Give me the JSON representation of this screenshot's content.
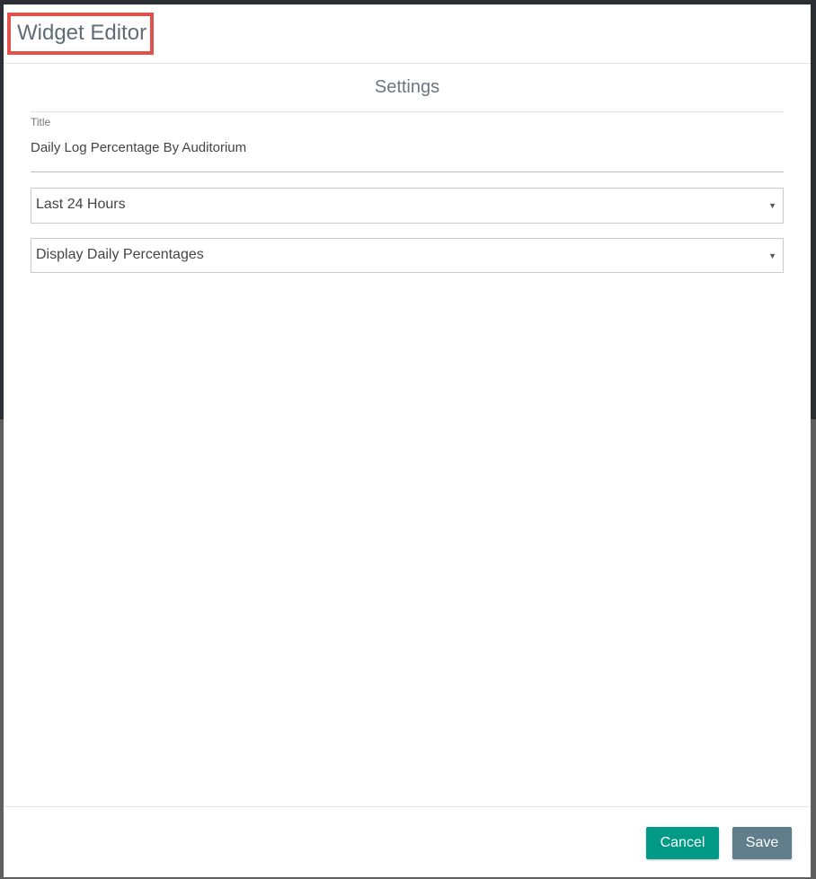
{
  "modal": {
    "title": "Widget Editor",
    "section_title": "Settings"
  },
  "form": {
    "title_label": "Title",
    "title_value": "Daily Log Percentage By Auditorium",
    "time_range_selected": "Last 24 Hours",
    "display_mode_selected": "Display Daily Percentages",
    "caret_glyph": "▼"
  },
  "footer": {
    "cancel_label": "Cancel",
    "save_label": "Save"
  },
  "colors": {
    "highlight": "#e3514c",
    "cancel_button": "#009a86",
    "save_button": "#607d8b"
  },
  "icons": {
    "time_range_caret": "caret-down-icon",
    "display_mode_caret": "caret-down-icon"
  }
}
